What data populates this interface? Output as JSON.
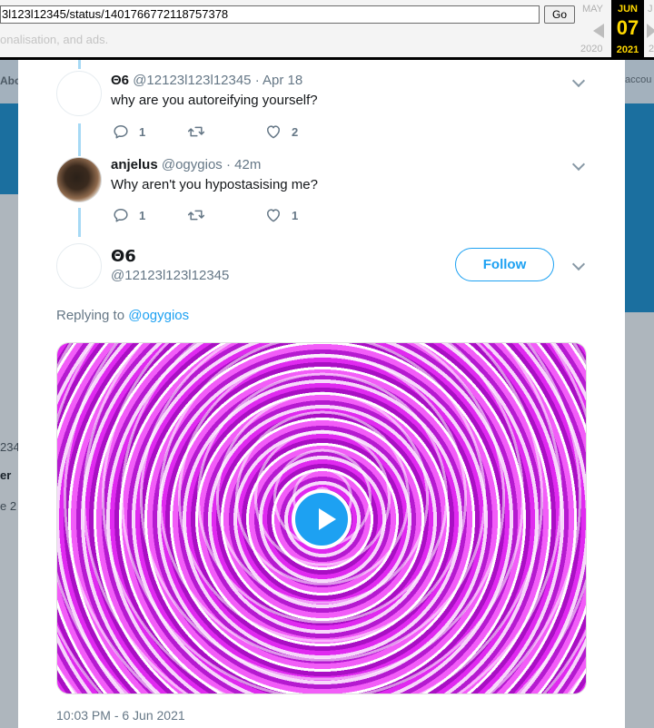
{
  "wayback": {
    "url": "3l123l12345/status/1401766772118757378",
    "go_label": "Go",
    "ghost_text": "onalisation, and ads.",
    "prev_month": "MAY",
    "prev_year": "2020",
    "current_month": "JUN",
    "current_day": "07",
    "current_year": "2021",
    "next_year": "2",
    "next_month": "J"
  },
  "background": {
    "about_label": "Abo",
    "account_label": "accou",
    "side_line1": "234",
    "side_line2": "er",
    "side_line3": "e 2"
  },
  "thread": [
    {
      "name": "Θ6",
      "handle": "@12123l123l12345",
      "sep": "·",
      "time": "Apr 18",
      "text": "why are you autoreifying yourself?",
      "replies": "1",
      "likes": "2"
    },
    {
      "name": "anjelus",
      "handle": "@ogygios",
      "sep": "·",
      "time": "42m",
      "text": "Why aren't you hypostasising me?",
      "replies": "1",
      "likes": "1"
    }
  ],
  "main_tweet": {
    "name": "Θ6",
    "handle": "@12123l123l12345",
    "follow_label": "Follow",
    "replying_prefix": "Replying to",
    "replying_handle": "@ogygios",
    "timestamp": "10:03 PM - 6 Jun 2021"
  },
  "icons": [
    "reply-icon",
    "retweet-icon",
    "like-icon",
    "chevron-down-icon",
    "play-icon"
  ],
  "colors": {
    "twitter_blue": "#1da1f2",
    "thread_line": "#a6d9f5",
    "secondary_text": "#657786",
    "wayback_highlight": "#ffd800"
  }
}
